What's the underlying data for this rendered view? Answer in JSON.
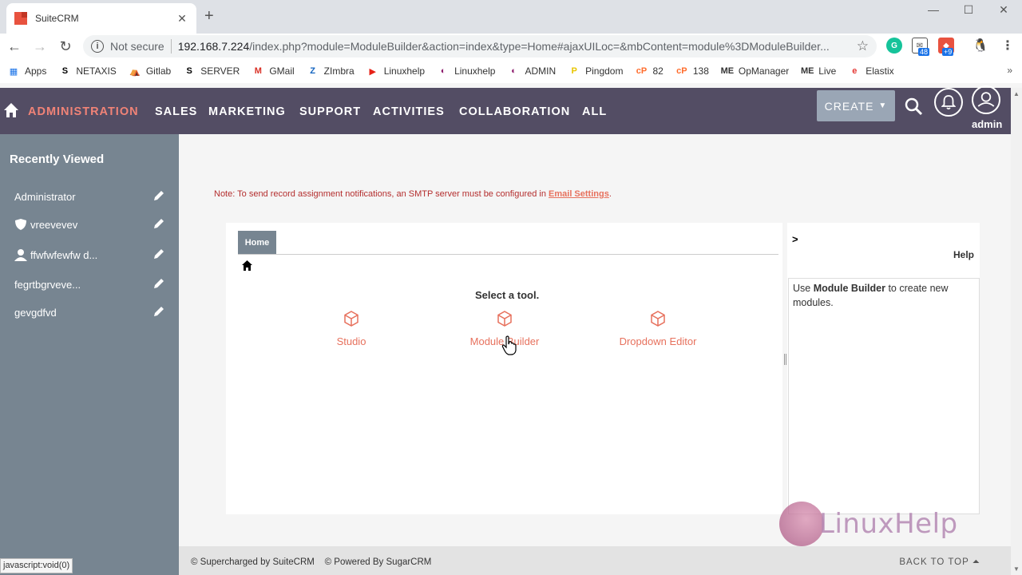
{
  "browser": {
    "tab_title": "SuiteCRM",
    "tab_close": "✕",
    "new_tab": "+",
    "window_controls": [
      "—",
      "☐",
      "✕"
    ],
    "not_secure": "Not secure",
    "url_host": "192.168.7.224",
    "url_path": "/index.php?module=ModuleBuilder&action=index&type=Home#ajaxUILoc=&mbContent=module%3DModuleBuilder...",
    "extension_badges": [
      "48",
      "+9"
    ],
    "bookmarks": [
      {
        "label": "Apps",
        "icon": "apps-grid-icon",
        "glyph": "▦",
        "color": "#1a73e8"
      },
      {
        "label": "NETAXIS",
        "icon": "netaxis-icon",
        "glyph": "S",
        "color": "#000000"
      },
      {
        "label": "Gitlab",
        "icon": "gitlab-icon",
        "glyph": "⛺",
        "color": "#555555"
      },
      {
        "label": "SERVER",
        "icon": "server-icon",
        "glyph": "S",
        "color": "#000000"
      },
      {
        "label": "GMail",
        "icon": "gmail-icon",
        "glyph": "M",
        "color": "#d93025"
      },
      {
        "label": "ZImbra",
        "icon": "zimbra-icon",
        "glyph": "Z",
        "color": "#1565c0"
      },
      {
        "label": "Linuxhelp",
        "icon": "youtube-icon",
        "glyph": "▶",
        "color": "#e62117"
      },
      {
        "label": "Linuxhelp",
        "icon": "linuxhelp-icon",
        "glyph": "◐",
        "color": "#8e1e6e"
      },
      {
        "label": "ADMIN",
        "icon": "admin-icon",
        "glyph": "◐",
        "color": "#8e1e6e"
      },
      {
        "label": "Pingdom",
        "icon": "pingdom-icon",
        "glyph": "P",
        "color": "#e8c500"
      },
      {
        "label": "82",
        "icon": "cpanel-icon",
        "glyph": "cP",
        "color": "#ff6c2c"
      },
      {
        "label": "138",
        "icon": "cpanel-icon",
        "glyph": "cP",
        "color": "#ff6c2c"
      },
      {
        "label": "OpManager",
        "icon": "opmanager-icon",
        "glyph": "ME",
        "color": "#333333"
      },
      {
        "label": "Live",
        "icon": "live-icon",
        "glyph": "ME",
        "color": "#333333"
      },
      {
        "label": "Elastix",
        "icon": "elastix-icon",
        "glyph": "e",
        "color": "#e53935"
      }
    ],
    "bookmarks_more": "»",
    "status_tip": "javascript:void(0)"
  },
  "nav": {
    "items": [
      "ADMINISTRATION",
      "SALES",
      "MARKETING",
      "SUPPORT",
      "ACTIVITIES",
      "COLLABORATION",
      "ALL"
    ],
    "create_label": "CREATE",
    "user_label": "admin",
    "colors": {
      "bar": "#534d64",
      "active": "#f08377"
    }
  },
  "sidebar": {
    "title": "Recently Viewed",
    "items": [
      {
        "label": "Administrator",
        "icon": "none"
      },
      {
        "label": "vreevevev",
        "icon": "shield-icon"
      },
      {
        "label": "ffwfwfewfw d...",
        "icon": "person-icon"
      },
      {
        "label": "fegrtbgrveve...",
        "icon": "none"
      },
      {
        "label": "gevgdfvd",
        "icon": "none"
      }
    ]
  },
  "main": {
    "note_text": "Note: To send record assignment notifications, an SMTP server must be configured in ",
    "note_link": "Email Settings",
    "note_end": ".",
    "tab_label": "Home",
    "select_tool": "Select a tool.",
    "tools": [
      "Studio",
      "Module Builder",
      "Dropdown Editor"
    ],
    "help_arrow": ">",
    "help_label": "Help",
    "help_pre": "Use ",
    "help_bold": "Module Builder",
    "help_post": " to create new modules.",
    "watermark": "LinuxHelp"
  },
  "footer": {
    "left": "© Supercharged by SuiteCRM    © Powered By SugarCRM",
    "back_to_top": "BACK TO TOP ⏶"
  }
}
